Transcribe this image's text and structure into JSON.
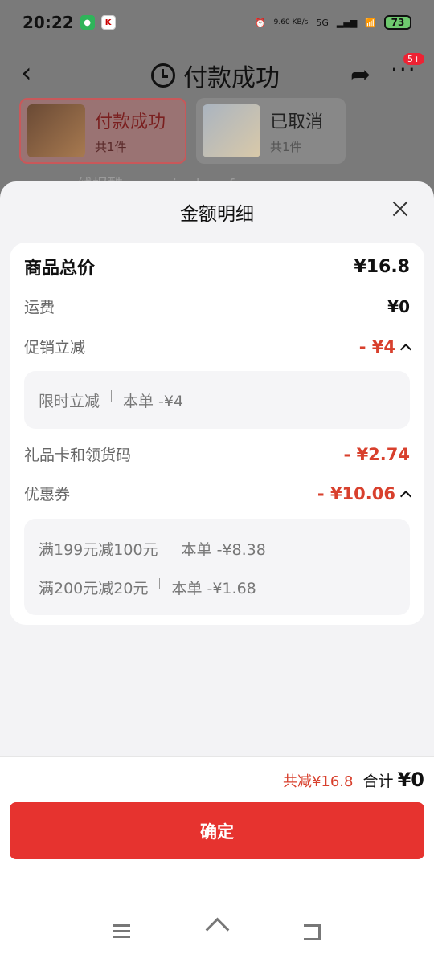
{
  "status_bar": {
    "time": "20:22",
    "net_speed": "9.60 KB/s",
    "network": "5G",
    "battery": "73"
  },
  "top_nav": {
    "title": "付款成功",
    "badge": "5+"
  },
  "order_tabs": [
    {
      "status": "付款成功",
      "count": "共1件"
    },
    {
      "status": "已取消",
      "count": "共1件"
    }
  ],
  "watermark": "线报酷-new.xianbao.fun",
  "sheet": {
    "title": "金额明细",
    "rows": {
      "total": {
        "label": "商品总价",
        "value": "¥16.8"
      },
      "shipping": {
        "label": "运费",
        "value": "¥0"
      },
      "promo": {
        "label": "促销立减",
        "value": "- ¥4"
      },
      "gift": {
        "label": "礼品卡和领货码",
        "value": "- ¥2.74"
      },
      "coupon": {
        "label": "优惠券",
        "value": "- ¥10.06"
      }
    },
    "promo_details": [
      {
        "name": "限时立减",
        "amount": "本单 -¥4"
      }
    ],
    "coupon_details": [
      {
        "name": "满199元减100元",
        "amount": "本单 -¥8.38"
      },
      {
        "name": "满200元减20元",
        "amount": "本单 -¥1.68"
      }
    ]
  },
  "footer": {
    "saved": "共减¥16.8",
    "total_label": "合计",
    "total_value": "¥0",
    "confirm_label": "确定"
  }
}
